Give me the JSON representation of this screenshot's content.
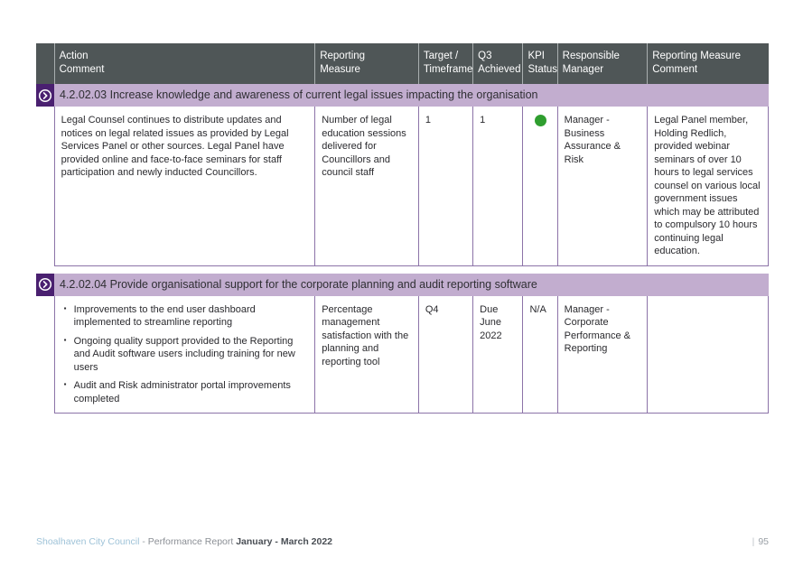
{
  "table": {
    "columns": [
      {
        "line1": "Action",
        "line2": "Comment",
        "key": "action"
      },
      {
        "line1": "Reporting",
        "line2": "Measure",
        "key": "measure"
      },
      {
        "line1": "Target /",
        "line2": "Timeframe",
        "key": "target"
      },
      {
        "line1": "Q3",
        "line2": "Achieved",
        "key": "q3"
      },
      {
        "line1": "KPI",
        "line2": "Status",
        "key": "kpi"
      },
      {
        "line1": "Responsible",
        "line2": "Manager",
        "key": "manager"
      },
      {
        "line1": "Reporting Measure",
        "line2": "Comment",
        "key": "comment"
      }
    ],
    "sections": [
      {
        "icon": "chevron-right-circle-icon",
        "banner_code": "4.2.02.03",
        "banner_title": "Increase knowledge and awareness of current legal issues impacting the organisation",
        "banner_text": "4.2.02.03 Increase knowledge and awareness of current legal issues impacting the organisation",
        "row": {
          "action": "Legal Counsel continues to distribute updates and notices on legal related issues as provided by Legal Services Panel or other sources. Legal Panel have provided online and face-to-face seminars for staff participation and newly inducted Councillors.",
          "action_bullets": [],
          "measure": "Number of legal education sessions delivered for Councillors and council staff",
          "target": "1",
          "q3": "1",
          "kpi_status": "green",
          "kpi_text": "",
          "kpi_color": "#2f9e2f",
          "manager": "Manager - Business Assurance & Risk",
          "comment": "Legal Panel member, Holding Redlich, provided webinar seminars of over 10 hours to legal services counsel on various local government issues which may be attributed to compulsory 10 hours continuing legal education."
        }
      },
      {
        "icon": "chevron-right-circle-icon",
        "banner_code": "4.2.02.04",
        "banner_title": "Provide organisational support for the corporate planning and audit reporting software",
        "banner_text": "4.2.02.04 Provide organisational support for the corporate planning and audit reporting software",
        "row": {
          "action": "",
          "action_bullets": [
            "Improvements to the end user dashboard implemented to streamline reporting",
            "Ongoing quality support provided to the Reporting and Audit software users including training for new users",
            "Audit and Risk administrator portal improvements completed"
          ],
          "measure": "Percentage management satisfaction with the planning and reporting tool",
          "target": "Q4",
          "q3": "Due June 2022",
          "kpi_status": "none",
          "kpi_text": "N/A",
          "kpi_color": "",
          "manager": "Manager - Corporate Performance & Reporting",
          "comment": ""
        }
      }
    ]
  },
  "footer": {
    "brand": "Shoalhaven City Council",
    "separator": "-",
    "middle": "Performance Report",
    "period": "January - March 2022",
    "page_pipe": "|",
    "page_number": "95"
  },
  "colors": {
    "header_bg": "#4f5657",
    "banner_bg": "#c2adcf",
    "banner_icon_bg": "#4a2070",
    "cell_border": "#8c73a8",
    "kpi_green": "#2f9e2f",
    "footer_brand": "#9fc3d8"
  }
}
